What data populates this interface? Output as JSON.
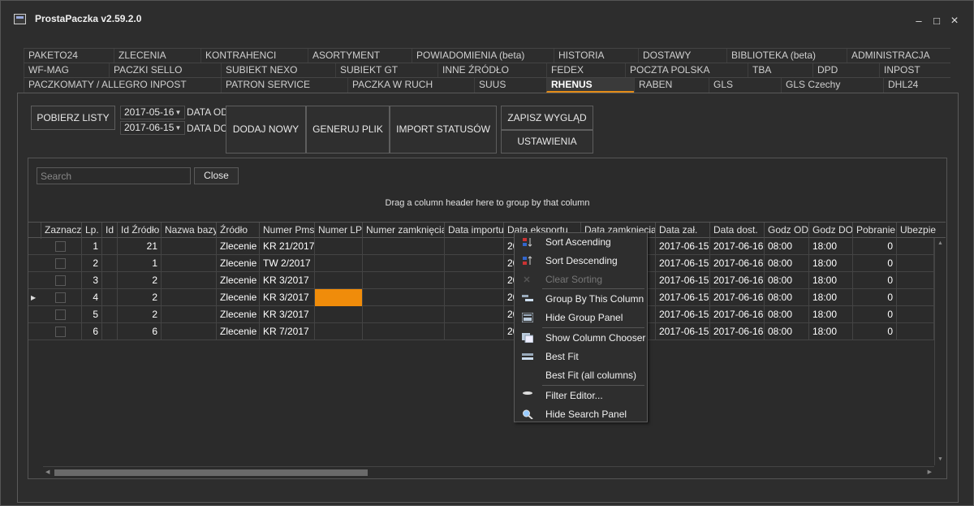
{
  "window": {
    "title": "ProstaPaczka v2.59.2.0",
    "minimize": "–",
    "maximize": "□",
    "close": "×"
  },
  "tabs": {
    "row1": [
      "PAKETO24",
      "ZLECENIA",
      "KONTRAHENCI",
      "ASORTYMENT",
      "POWIADOMIENIA (beta)",
      "HISTORIA",
      "DOSTAWY",
      "BIBLIOTEKA (beta)",
      "ADMINISTRACJA"
    ],
    "row2": [
      "WF-MAG",
      "PACZKI SELLO",
      "SUBIEKT NEXO",
      "SUBIEKT GT",
      "INNE ŹRÓDŁO",
      "FEDEX",
      "POCZTA POLSKA",
      "TBA",
      "DPD",
      "INPOST"
    ],
    "row3": [
      "PACZKOMATY / ALLEGRO INPOST",
      "PATRON SERVICE",
      "PACZKA W RUCH",
      "SUUS",
      "RHENUS",
      "RABEN",
      "GLS",
      "GLS Czechy",
      "DHL24"
    ],
    "active": "RHENUS"
  },
  "toolbar": {
    "fetch_label": "POBIERZ LISTY",
    "date_from": "2017-05-16",
    "date_to": "2017-06-15",
    "date_from_label": "DATA OD",
    "date_to_label": "DATA DO",
    "add_new_label": "DODAJ NOWY",
    "generate_file_label": "GENERUJ PLIK",
    "import_status_label": "IMPORT STATUSÓW",
    "save_layout_label": "ZAPISZ WYGLĄD",
    "settings_label": "USTAWIENIA"
  },
  "search": {
    "placeholder": "Search",
    "close_label": "Close"
  },
  "grid": {
    "group_hint": "Drag a column header here to group by that column",
    "columns": [
      "Zaznacz",
      "Lp.",
      "Id",
      "Id Źródło",
      "Nazwa bazy",
      "Źródło",
      "Numer Pms",
      "Numer LP",
      "Numer zamknięcia",
      "Data importu",
      "Data eksportu",
      "Data zamknięcia",
      "Data zał.",
      "Data dost.",
      "Godz OD",
      "Godz DO",
      "Pobranie",
      "Ubezpie"
    ],
    "rows": [
      {
        "lp": "1",
        "id_zrodlo": "21",
        "zrodlo": "Zlecenie",
        "numer_pms": "KR 21/2017",
        "data_eksportu": "20",
        "data_zal": "2017-06-15",
        "data_dost": "2017-06-16",
        "godz_od": "08:00",
        "godz_do": "18:00",
        "pobranie": "0"
      },
      {
        "lp": "2",
        "id_zrodlo": "1",
        "zrodlo": "Zlecenie",
        "numer_pms": "TW 2/2017",
        "data_eksportu": "20",
        "data_zal": "2017-06-15",
        "data_dost": "2017-06-16",
        "godz_od": "08:00",
        "godz_do": "18:00",
        "pobranie": "0"
      },
      {
        "lp": "3",
        "id_zrodlo": "2",
        "zrodlo": "Zlecenie",
        "numer_pms": "KR 3/2017",
        "data_eksportu": "20",
        "data_zal": "2017-06-15",
        "data_dost": "2017-06-16",
        "godz_od": "08:00",
        "godz_do": "18:00",
        "pobranie": "0"
      },
      {
        "lp": "4",
        "id_zrodlo": "2",
        "zrodlo": "Zlecenie",
        "numer_pms": "KR 3/2017",
        "data_eksportu": "20",
        "data_zal": "2017-06-15",
        "data_dost": "2017-06-16",
        "godz_od": "08:00",
        "godz_do": "18:00",
        "pobranie": "0"
      },
      {
        "lp": "5",
        "id_zrodlo": "2",
        "zrodlo": "Zlecenie",
        "numer_pms": "KR 3/2017",
        "data_eksportu": "20",
        "data_zal": "2017-06-15",
        "data_dost": "2017-06-16",
        "godz_od": "08:00",
        "godz_do": "18:00",
        "pobranie": "0"
      },
      {
        "lp": "6",
        "id_zrodlo": "6",
        "zrodlo": "Zlecenie",
        "numer_pms": "KR 7/2017",
        "data_eksportu": "20",
        "data_zal": "2017-06-15",
        "data_dost": "2017-06-16",
        "godz_od": "08:00",
        "godz_do": "18:00",
        "pobranie": "0"
      }
    ],
    "highlight_color": "#f08c0a"
  },
  "context_menu": {
    "items": [
      {
        "label": "Sort Ascending",
        "icon": "sort-ascending-icon",
        "disabled": false
      },
      {
        "label": "Sort Descending",
        "icon": "sort-descending-icon",
        "disabled": false
      },
      {
        "label": "Clear Sorting",
        "icon": "clear-sorting-icon",
        "disabled": true
      },
      {
        "label": "Group By This Column",
        "icon": "group-by-icon",
        "disabled": false
      },
      {
        "label": "Hide Group Panel",
        "icon": "group-panel-icon",
        "disabled": false
      },
      {
        "label": "Show Column Chooser",
        "icon": "column-chooser-icon",
        "disabled": false
      },
      {
        "label": "Best Fit",
        "icon": "best-fit-icon",
        "disabled": false
      },
      {
        "label": "Best Fit (all columns)",
        "icon": "",
        "disabled": false
      },
      {
        "label": "Filter Editor...",
        "icon": "filter-icon",
        "disabled": false
      },
      {
        "label": "Hide Search Panel",
        "icon": "search-icon",
        "disabled": false
      }
    ]
  }
}
